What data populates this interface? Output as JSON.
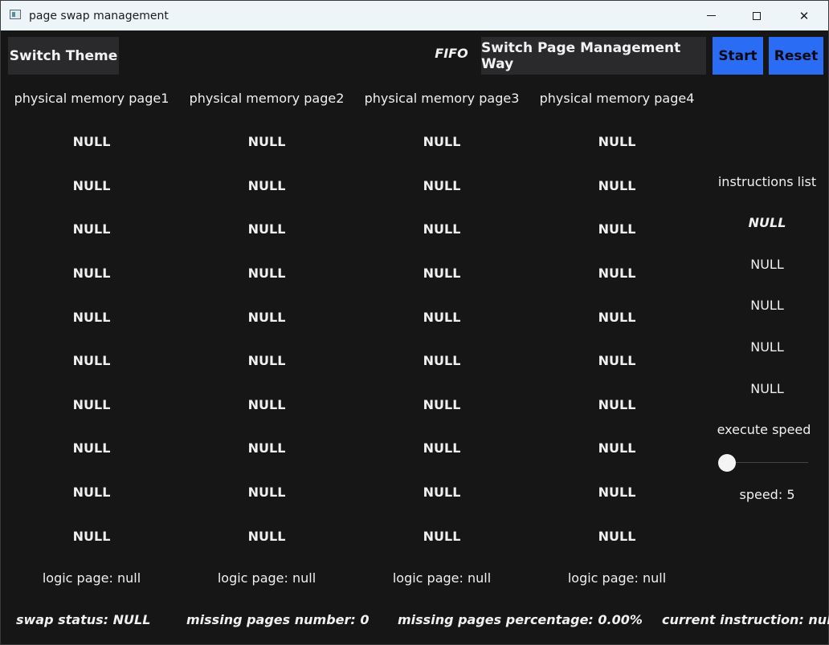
{
  "window": {
    "title": "page swap management"
  },
  "toolbar": {
    "switch_theme_label": "Switch Theme",
    "mode_label": "FIFO",
    "switch_way_label": "Switch Page Management Way",
    "start_label": "Start",
    "reset_label": "Reset"
  },
  "colors": {
    "background": "#161616",
    "accent_button": "#2b6cf4",
    "dark_button": "#2a2a2c"
  },
  "memory_pages": [
    {
      "header": "physical memory page1",
      "cells": [
        "NULL",
        "NULL",
        "NULL",
        "NULL",
        "NULL",
        "NULL",
        "NULL",
        "NULL",
        "NULL",
        "NULL"
      ],
      "logic_page": "logic page: null"
    },
    {
      "header": "physical memory page2",
      "cells": [
        "NULL",
        "NULL",
        "NULL",
        "NULL",
        "NULL",
        "NULL",
        "NULL",
        "NULL",
        "NULL",
        "NULL"
      ],
      "logic_page": "logic page: null"
    },
    {
      "header": "physical memory page3",
      "cells": [
        "NULL",
        "NULL",
        "NULL",
        "NULL",
        "NULL",
        "NULL",
        "NULL",
        "NULL",
        "NULL",
        "NULL"
      ],
      "logic_page": "logic page: null"
    },
    {
      "header": "physical memory page4",
      "cells": [
        "NULL",
        "NULL",
        "NULL",
        "NULL",
        "NULL",
        "NULL",
        "NULL",
        "NULL",
        "NULL",
        "NULL"
      ],
      "logic_page": "logic page: null"
    }
  ],
  "instructions": {
    "title": "instructions list",
    "items": [
      "NULL",
      "NULL",
      "NULL",
      "NULL",
      "NULL"
    ]
  },
  "speed": {
    "title": "execute speed",
    "label": "speed: 5",
    "value": 5,
    "slider_fraction": 0.0
  },
  "status": {
    "swap": "swap status: NULL",
    "missing": "missing pages number: 0",
    "percentage": "missing pages percentage: 0.00%",
    "current": "current instruction: null"
  }
}
